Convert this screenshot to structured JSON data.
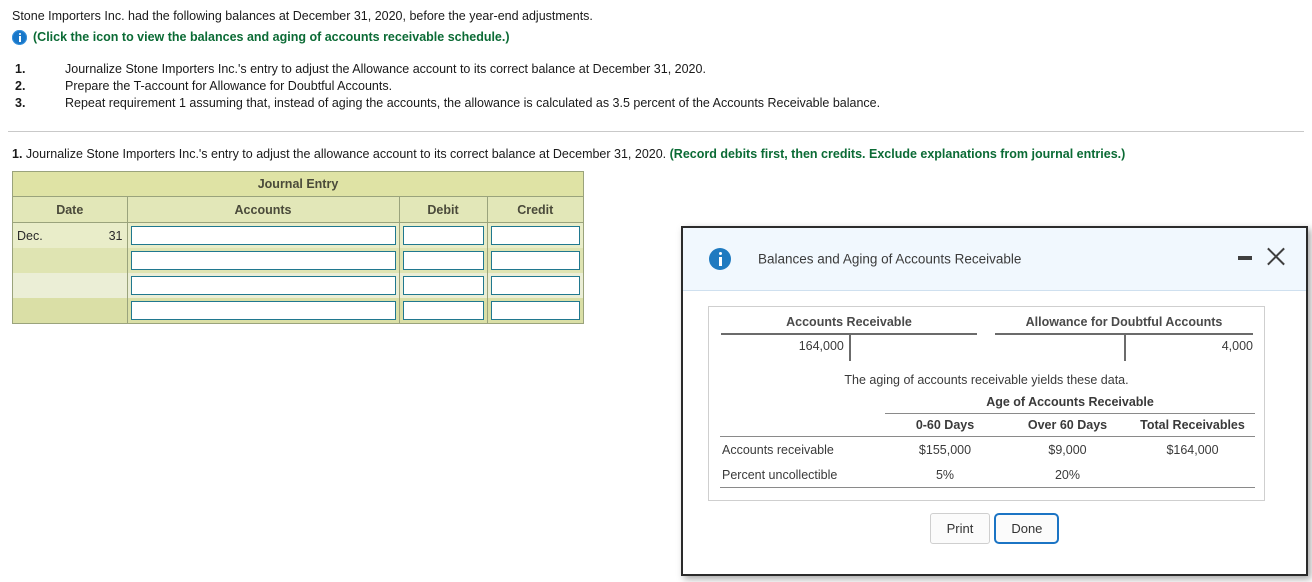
{
  "problem": {
    "intro": "Stone Importers Inc. had the following balances at December 31, 2020, before the year-end adjustments.",
    "click_icon_text": "(Click the icon to view the balances and aging of accounts receivable schedule.)",
    "info_icon": "info-icon",
    "requirements": [
      {
        "num": "1.",
        "text": "Journalize Stone Importers Inc.'s entry to adjust the Allowance account to its correct balance at December 31, 2020."
      },
      {
        "num": "2.",
        "text": "Prepare the T-account for Allowance for Doubtful Accounts."
      },
      {
        "num": "3.",
        "text": "Repeat requirement 1 assuming that, instead of aging the accounts, the allowance is calculated as 3.5 percent of the Accounts Receivable balance."
      }
    ]
  },
  "requirement_one": {
    "number": "1.",
    "prompt": "Journalize Stone Importers Inc.'s entry to adjust the allowance account to its correct balance at December 31, 2020.",
    "instruction": "(Record debits first, then credits. Exclude explanations from journal entries.)"
  },
  "journal": {
    "title": "Journal Entry",
    "columns": [
      "Date",
      "Accounts",
      "Debit",
      "Credit"
    ],
    "rows": [
      {
        "month": "Dec.",
        "day": "31",
        "accounts": "",
        "debit": "",
        "credit": ""
      },
      {
        "month": "",
        "day": "",
        "accounts": "",
        "debit": "",
        "credit": ""
      },
      {
        "month": "",
        "day": "",
        "accounts": "",
        "debit": "",
        "credit": ""
      },
      {
        "month": "",
        "day": "",
        "accounts": "",
        "debit": "",
        "credit": ""
      }
    ],
    "colors": {
      "header": "#dfe3a5",
      "column_header": "#e2e7b8",
      "border": "#9aa37c",
      "input_border": "#20788f"
    }
  },
  "dialog": {
    "title": "Balances and Aging of Accounts Receivable",
    "info_icon": "info-icon",
    "minimize_icon": "minimize-icon",
    "close_icon": "close-icon",
    "t_accounts": [
      {
        "title": "Accounts Receivable",
        "debit": "164,000",
        "credit": ""
      },
      {
        "title": "Allowance for Doubtful Accounts",
        "debit": "",
        "credit": "4,000"
      }
    ],
    "aging_note": "The aging of accounts receivable yields these data.",
    "aging": {
      "span_header": "Age of Accounts Receivable",
      "columns": [
        "",
        "0-60 Days",
        "Over 60 Days",
        "Total Receivables"
      ],
      "rows": [
        {
          "label": "Accounts receivable",
          "c1": "$155,000",
          "c2": "$9,000",
          "c3": "$164,000"
        },
        {
          "label": "Percent uncollectible",
          "c1": "5%",
          "c2": "20%",
          "c3": ""
        }
      ]
    },
    "buttons": {
      "print": "Print",
      "done": "Done"
    }
  }
}
